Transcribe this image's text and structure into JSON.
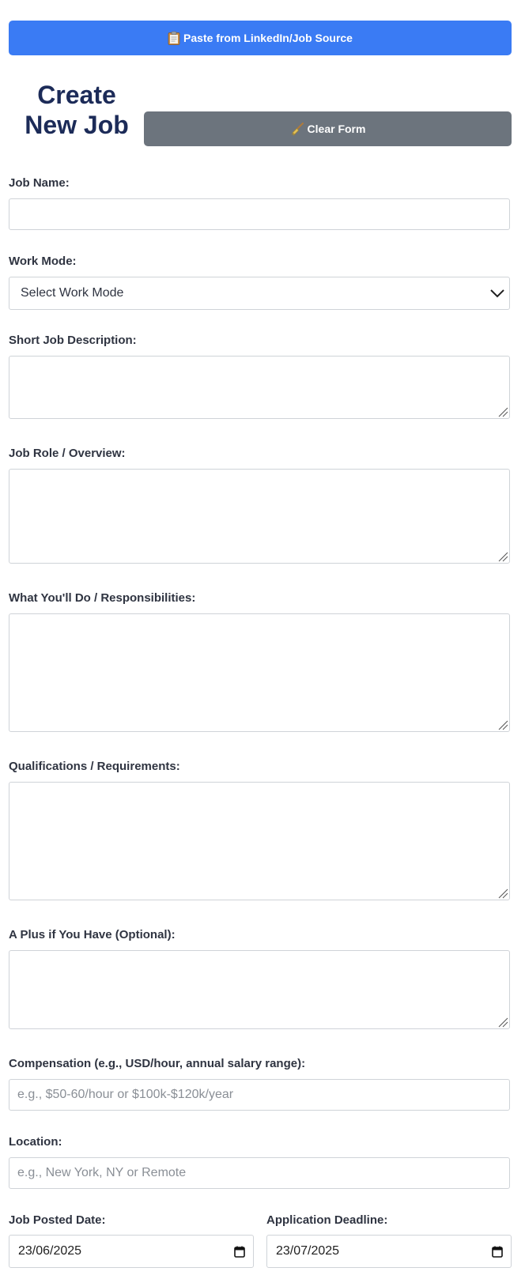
{
  "toolbar": {
    "paste_label": "Paste from LinkedIn/Job Source",
    "paste_icon": "clipboard-icon",
    "clear_label": "Clear Form",
    "clear_icon": "broom-icon"
  },
  "header": {
    "title": "Create New Job"
  },
  "form": {
    "job_name": {
      "label": "Job Name:",
      "value": ""
    },
    "work_mode": {
      "label": "Work Mode:",
      "selected": "Select Work Mode"
    },
    "short_description": {
      "label": "Short Job Description:",
      "value": ""
    },
    "role_overview": {
      "label": "Job Role / Overview:",
      "value": ""
    },
    "responsibilities": {
      "label": "What You'll Do / Responsibilities:",
      "value": ""
    },
    "qualifications": {
      "label": "Qualifications / Requirements:",
      "value": ""
    },
    "plus": {
      "label": "A Plus if You Have (Optional):",
      "value": ""
    },
    "compensation": {
      "label": "Compensation (e.g., USD/hour, annual salary range):",
      "placeholder": "e.g., $50-60/hour or $100k-$120k/year"
    },
    "location": {
      "label": "Location:",
      "placeholder": "e.g., New York, NY or Remote"
    },
    "posted_date": {
      "label": "Job Posted Date:",
      "value": "23/06/2025"
    },
    "deadline": {
      "label": "Application Deadline:",
      "value": "23/07/2025"
    }
  },
  "colors": {
    "primary_button": "#3a7bf4",
    "secondary_button": "#6c747d",
    "title": "#1c2b58",
    "border": "#cfd3d8"
  }
}
